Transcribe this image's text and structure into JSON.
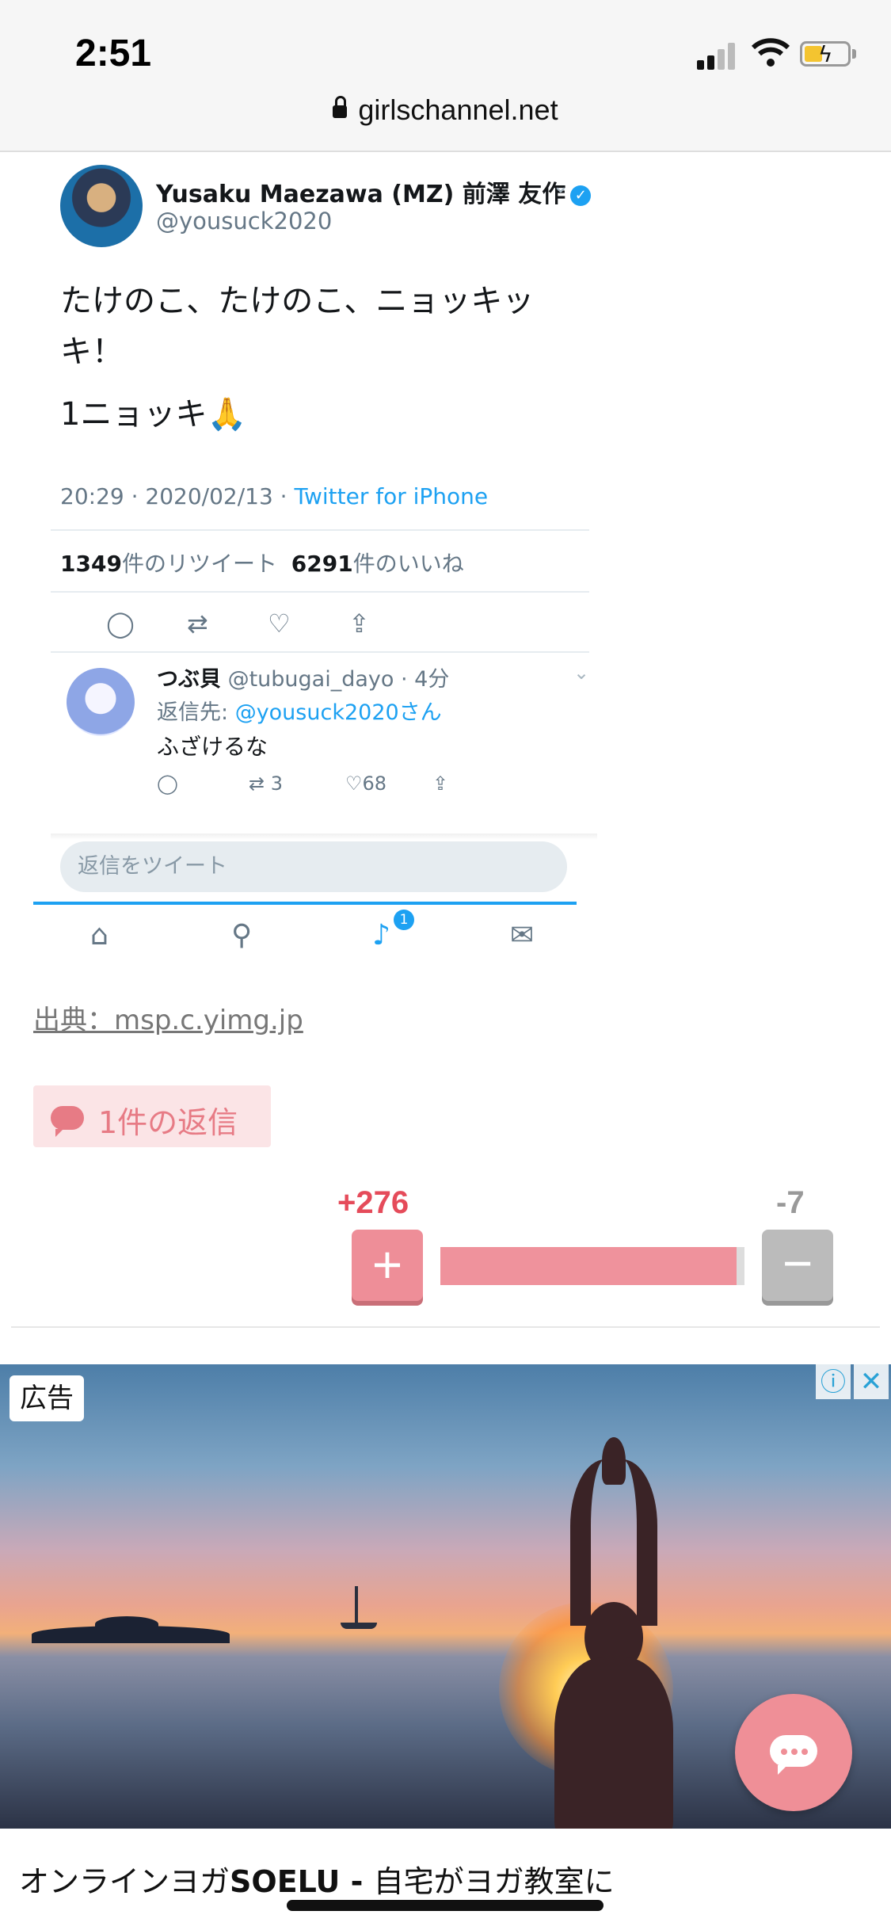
{
  "status_bar": {
    "time": "2:51"
  },
  "browser": {
    "url": "girlschannel.net"
  },
  "tweet": {
    "name": "Yusaku Maezawa (MZ) 前澤 友作",
    "handle": "@yousuck2020",
    "text_line1": "たけのこ、たけのこ、ニョッキッキ！",
    "text_line2": "1ニョッキ🙏",
    "time": "20:29 · 2020/02/13 · ",
    "source": "Twitter for iPhone",
    "retweets": "1349",
    "retweets_label": "件のリツイート",
    "likes": "6291",
    "likes_label": "件のいいね",
    "reply": {
      "name": "つぶ貝",
      "handle_time": " @tubugai_dayo · 4分",
      "reply_to_label": "返信先: ",
      "reply_to": "@yousuck2020さん",
      "text": "ふざけるな",
      "retweets": "3",
      "likes": "68"
    },
    "reply_placeholder": "返信をツイート",
    "notification_badge": "1"
  },
  "source_link": "出典：msp.c.yimg.jp",
  "reply_button": "1件の返信",
  "vote": {
    "plus": "+276",
    "minus": "-7",
    "plus_fraction": 0.975
  },
  "ad": {
    "label": "広告",
    "title_pre": "オンラインヨガ",
    "title_brand": "SOELU - ",
    "title_post": "自宅がヨガ教室に"
  },
  "colors": {
    "accent": "#e77b85",
    "twitter_blue": "#1da1f2",
    "plus": "#e54b5a"
  }
}
